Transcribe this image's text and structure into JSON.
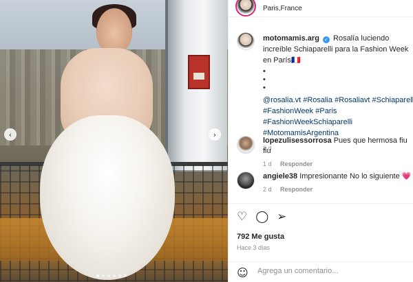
{
  "post": {
    "location": "Paris,France",
    "author": "motomamis.arg",
    "caption_text": "Rosalía luciendo increíble Schiaparelli para la Fashion Week en París🇫🇷",
    "bullets": [
      "•",
      "•",
      "•"
    ],
    "hashtags": [
      "@rosalia.vt",
      "#Rosalia",
      "#Rosaliavt",
      "#Schiaparelli",
      "#FashionWeek",
      "#Paris",
      "#FashionWeekSchiaparelli",
      "#MotomamisArgentina"
    ],
    "time": "3 d"
  },
  "comments": [
    {
      "user": "lopezulisessorrosa",
      "text": "Pues que hermosa fiu fiu",
      "time": "1 d",
      "reply": "Responder"
    },
    {
      "user": "angiele38",
      "text": "Impresionante No lo siguiente 💗",
      "time": "2 d",
      "reply": "Responder"
    }
  ],
  "icons": {
    "like": "heart-icon",
    "comment": "comment-icon",
    "share": "share-icon",
    "emoji": "emoji-icon",
    "prev": "chevron-left-icon",
    "next": "chevron-right-icon"
  },
  "likes": "792 Me gusta",
  "posted_ago": "Hace 3 días",
  "comment_input": {
    "placeholder": "Agrega un comentario..."
  },
  "carousel": {
    "total": 6,
    "active": 1
  },
  "colors": {
    "link": "#00376b",
    "verified": "#3897f0",
    "muted": "#8e8e8e"
  }
}
